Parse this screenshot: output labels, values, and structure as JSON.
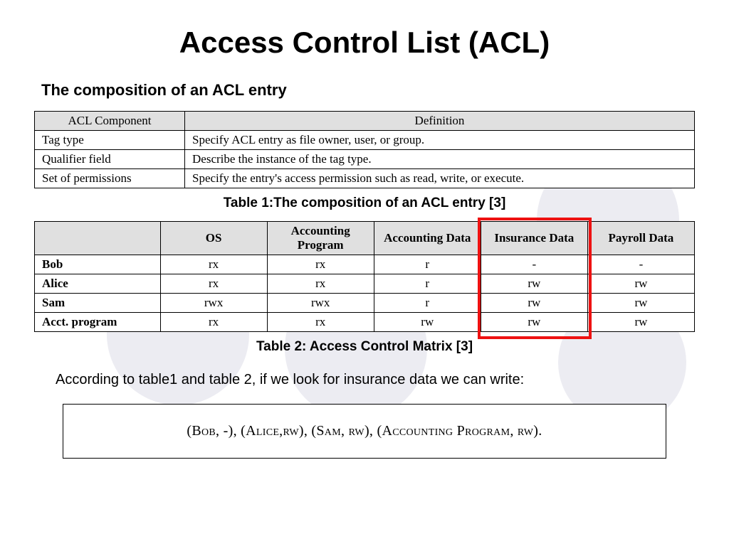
{
  "title": "Access Control List (ACL)",
  "subtitle": "The composition of an ACL entry",
  "table1": {
    "headers": [
      "ACL Component",
      "Definition"
    ],
    "rows": [
      [
        "Tag type",
        "Specify ACL entry as file owner, user, or group."
      ],
      [
        "Qualifier field",
        "Describe the instance of the tag type."
      ],
      [
        "Set of permissions",
        "Specify the entry's access permission such as read, write, or execute."
      ]
    ],
    "caption": "Table 1:The composition of an ACL entry [3]"
  },
  "table2": {
    "headers": [
      "",
      "OS",
      "Accounting Program",
      "Accounting Data",
      "Insurance Data",
      "Payroll Data"
    ],
    "rows": [
      [
        "Bob",
        "rx",
        "rx",
        "r",
        "-",
        "-"
      ],
      [
        "Alice",
        "rx",
        "rx",
        "r",
        "rw",
        "rw"
      ],
      [
        "Sam",
        "rwx",
        "rwx",
        "r",
        "rw",
        "rw"
      ],
      [
        "Acct. program",
        "rx",
        "rx",
        "rw",
        "rw",
        "rw"
      ]
    ],
    "caption": "Table 2: Access Control Matrix [3]",
    "highlighted_column_index": 4
  },
  "explain_line": "According to table1 and table 2, if we look for insurance data we can write:",
  "acl_result": "(Bob, -), (Alice,rw), (Sam, rw), (Accounting Program, rw)."
}
